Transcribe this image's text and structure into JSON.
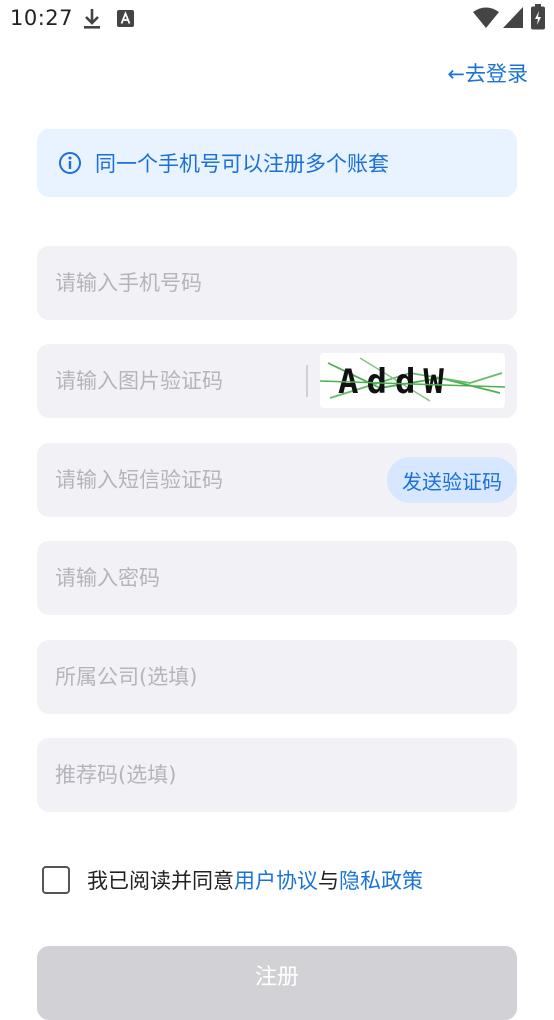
{
  "status_bar": {
    "time": "10:27",
    "icons": [
      "download-icon",
      "text-a-icon",
      "wifi-icon",
      "signal-icon",
      "battery-icon"
    ]
  },
  "header": {
    "back_login": "←去登录"
  },
  "notice": {
    "icon": "info-icon",
    "text": "同一个手机号可以注册多个账套"
  },
  "form": {
    "phone_placeholder": "请输入手机号码",
    "captcha_placeholder": "请输入图片验证码",
    "captcha_text": "AddW",
    "sms_placeholder": "请输入短信验证码",
    "send_code_label": "发送验证码",
    "password_placeholder": "请输入密码",
    "company_placeholder": "所属公司(选填)",
    "referral_placeholder": "推荐码(选填)"
  },
  "agreement": {
    "prefix": "我已阅读并同意",
    "user_agreement": "用户协议",
    "conjunction": "与",
    "privacy_policy": "隐私政策"
  },
  "register_label": "注册",
  "colors": {
    "accent": "#1a73d9",
    "notice_bg": "#e8f3ff",
    "field_bg": "#f2f2f6",
    "disabled_button": "#d2d2d6"
  }
}
